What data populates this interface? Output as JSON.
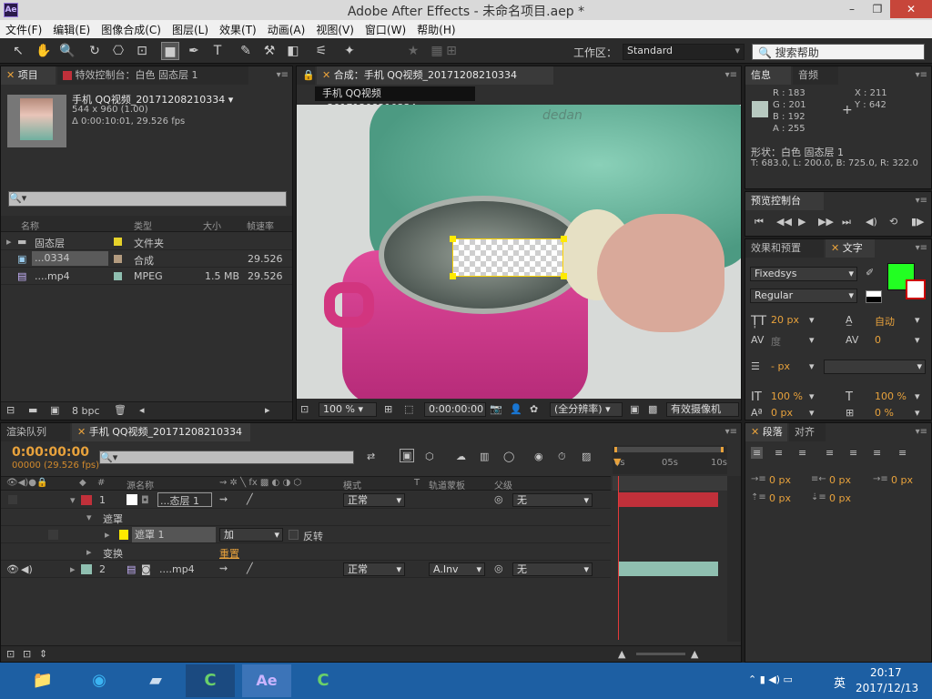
{
  "window": {
    "title": "Adobe After Effects - 未命名项目.aep *",
    "logo": "Ae",
    "minimize": "–",
    "restore": "❐",
    "close": "✕"
  },
  "menu": [
    "文件(F)",
    "编辑(E)",
    "图像合成(C)",
    "图层(L)",
    "效果(T)",
    "动画(A)",
    "视图(V)",
    "窗口(W)",
    "帮助(H)"
  ],
  "toolbar": {
    "workspace_label": "工作区：",
    "workspace_value": "Standard",
    "search_placeholder": "搜索帮助"
  },
  "project": {
    "tab_project": "项目",
    "tab_effects": "特效控制台：白色 固态层 1",
    "item_name": "手机 QQ视频_20171208210334 ▾",
    "item_size": "544 x 960 (1.00)",
    "item_duration": "Δ 0:00:10:01, 29.526 fps",
    "search_placeholder": "",
    "columns": [
      "名称",
      "类型",
      "大小",
      "帧速率"
    ],
    "rows": [
      {
        "name": "固态层",
        "type": "文件夹",
        "size": "",
        "fps": ""
      },
      {
        "name": "...0334",
        "type": "合成",
        "size": "",
        "fps": "29.526"
      },
      {
        "name": "....mp4",
        "type": "MPEG",
        "size": "1.5 MB",
        "fps": "29.526"
      }
    ],
    "bpc": "8 bpc"
  },
  "composition": {
    "tab": "合成：手机 QQ视频_20171208210334",
    "sub_tab": "手机 QQ视频_20171208210334",
    "video_text": "dedan",
    "zoom": "100 %",
    "timecode": "0:00:00:00",
    "resolution": "(全分辨率)",
    "camera": "有效摄像机"
  },
  "info": {
    "tab_info": "信息",
    "tab_audio": "音频",
    "r": "R : 183",
    "g": "G : 201",
    "b": "B : 192",
    "a": "A : 255",
    "x": "X : 211",
    "y": "Y : 642",
    "shape": "形状：白色 固态层 1",
    "coords": "T: 683.0, L: 200.0, B: 725.0, R: 322.0",
    "swatch": "#b7c9c0"
  },
  "preview": {
    "tab": "预览控制台"
  },
  "character": {
    "tab_effects": "效果和预置",
    "tab_text": "文字",
    "font": "Fixedsys",
    "style": "Regular",
    "size": "20 px",
    "leading": "自动",
    "kerning": "度",
    "tracking": "0",
    "stroke": "- px",
    "vscale": "100 %",
    "hscale": "100 %",
    "baseline": "0 px",
    "tsume": "0 %",
    "fill_color": "#22ff22"
  },
  "timeline": {
    "tab_render": "渲染队列",
    "tab_comp": "手机 QQ视频_20171208210334",
    "timecode": "0:00:00:00",
    "frames": "00000 (29.526 fps)",
    "search_placeholder": "",
    "columns": {
      "num": "#",
      "source": "源名称",
      "mode": "模式",
      "t": "T",
      "trkmat": "轨道蒙板",
      "parent": "父级"
    },
    "ruler": [
      "0s",
      "05s",
      "10s"
    ],
    "layers": [
      {
        "num": "1",
        "name": "...态层 1",
        "mode": "正常",
        "trkmat": "",
        "parent": "无",
        "color": "#c0303a"
      },
      {
        "num": "2",
        "name": "....mp4",
        "mode": "正常",
        "trkmat": "A.Inv",
        "parent": "无",
        "color": "#8fbfb0"
      }
    ],
    "mask_group": "遮罩",
    "mask_name": "遮罩 1",
    "mask_mode": "加",
    "invert": "反转",
    "transform": "变换",
    "reset": "重置"
  },
  "paragraph": {
    "tab_para": "段落",
    "tab_align": "对齐",
    "indent_left": "0 px",
    "indent_right": "0 px",
    "indent_first": "0 px",
    "space_before": "0 px",
    "space_after": "0 px"
  },
  "taskbar": {
    "time": "20:17",
    "date": "2017/12/13",
    "ime": "英"
  }
}
